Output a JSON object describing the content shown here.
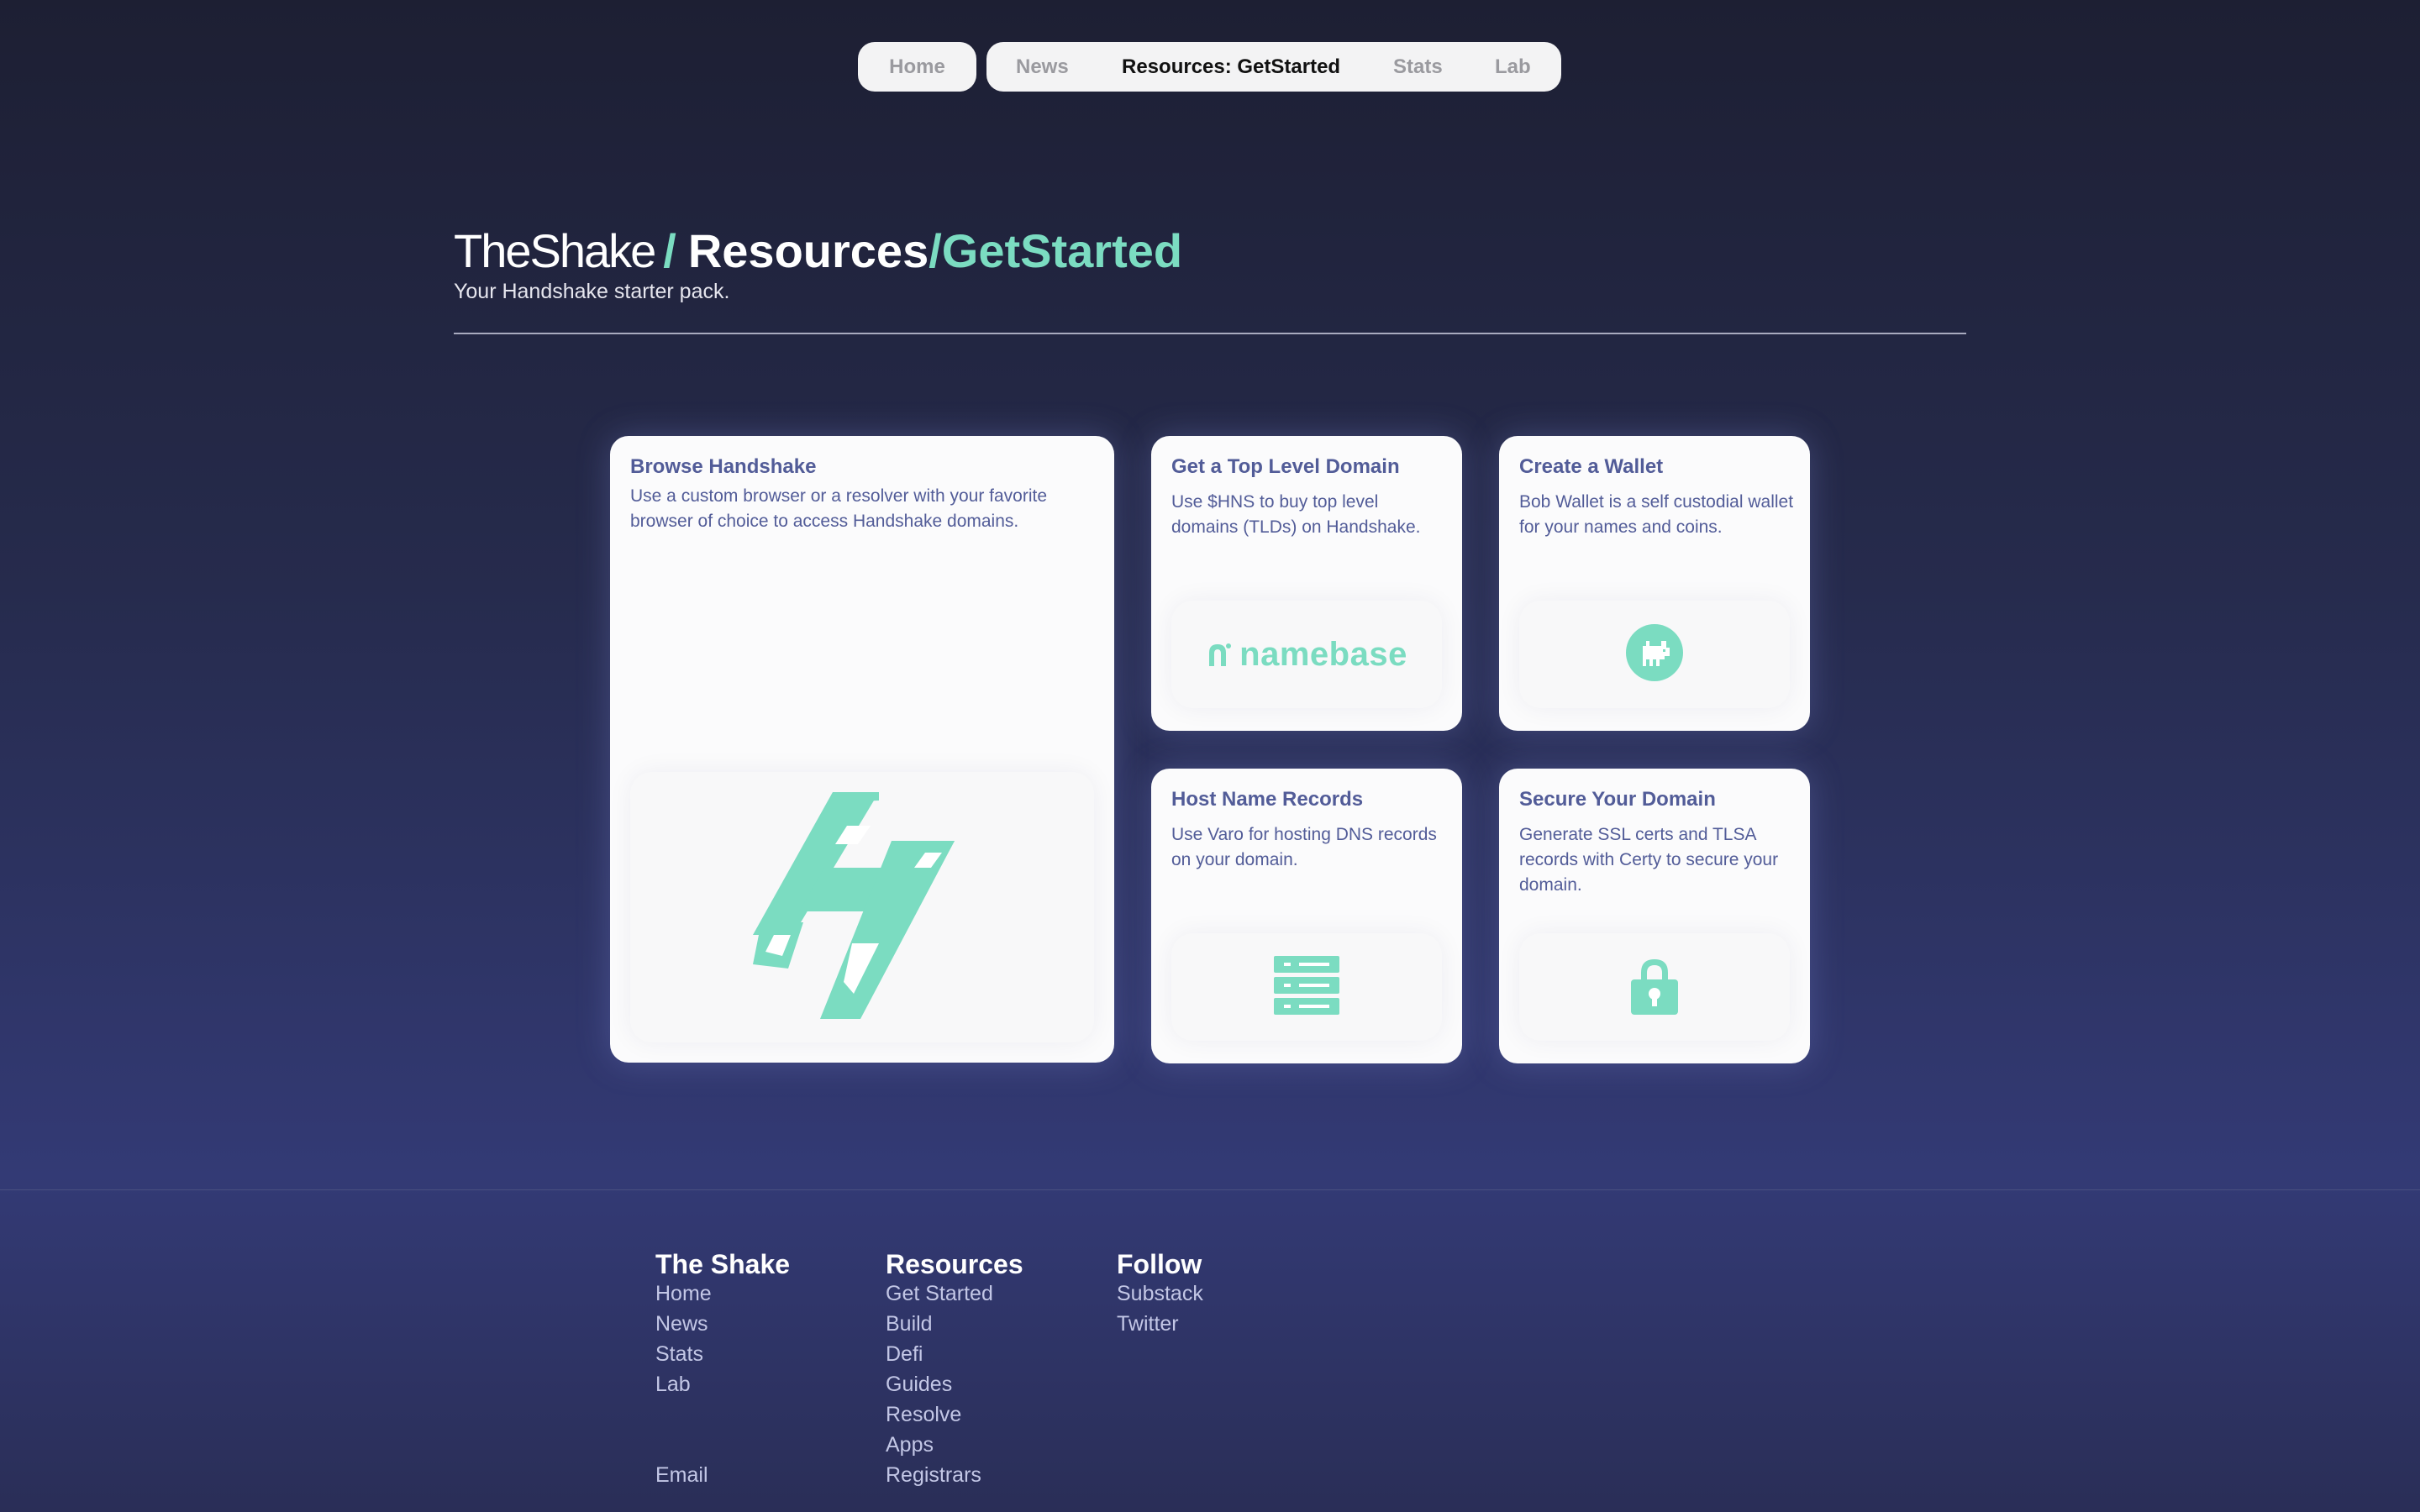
{
  "nav": {
    "home": "Home",
    "links": [
      "News",
      "Resources: GetStarted",
      "Stats",
      "Lab"
    ]
  },
  "heading": {
    "site": "TheShake",
    "slash": "/",
    "section": "Resources",
    "page": "/GetStarted",
    "subtitle": "Your Handshake starter pack."
  },
  "cards": {
    "browse": {
      "title": "Browse Handshake",
      "desc": "Use a custom browser or a resolver with your favorite browser of choice to access Handshake domains.",
      "icon": "handshake-logo-icon"
    },
    "tld": {
      "title": "Get a Top Level Domain",
      "desc": "Use $HNS to buy top level domains (TLDs) on Handshake.",
      "logo_text": "namebase"
    },
    "wallet": {
      "title": "Create a Wallet",
      "desc": "Bob Wallet is a self custodial wallet for your names and coins.",
      "icon": "bob-wallet-icon"
    },
    "records": {
      "title": "Host Name Records",
      "desc": "Use Varo for hosting DNS records on your domain.",
      "icon": "server-icon"
    },
    "secure": {
      "title": "Secure Your Domain",
      "desc": "Generate SSL certs and TLSA records with Certy to secure your domain.",
      "icon": "lock-icon"
    }
  },
  "footer": {
    "col1": {
      "title": "The Shake",
      "links": [
        "Home",
        "News",
        "Stats",
        "Lab"
      ],
      "email": "Email"
    },
    "col2": {
      "title": "Resources",
      "links": [
        "Get Started",
        "Build",
        "Defi",
        "Guides",
        "Resolve",
        "Apps",
        "Registrars"
      ]
    },
    "col3": {
      "title": "Follow",
      "links": [
        "Substack",
        "Twitter"
      ]
    }
  },
  "colors": {
    "accent": "#7bdcc1",
    "card_text": "#525c98",
    "bg_top": "#1d1f33",
    "bg_bottom": "#333a75"
  }
}
